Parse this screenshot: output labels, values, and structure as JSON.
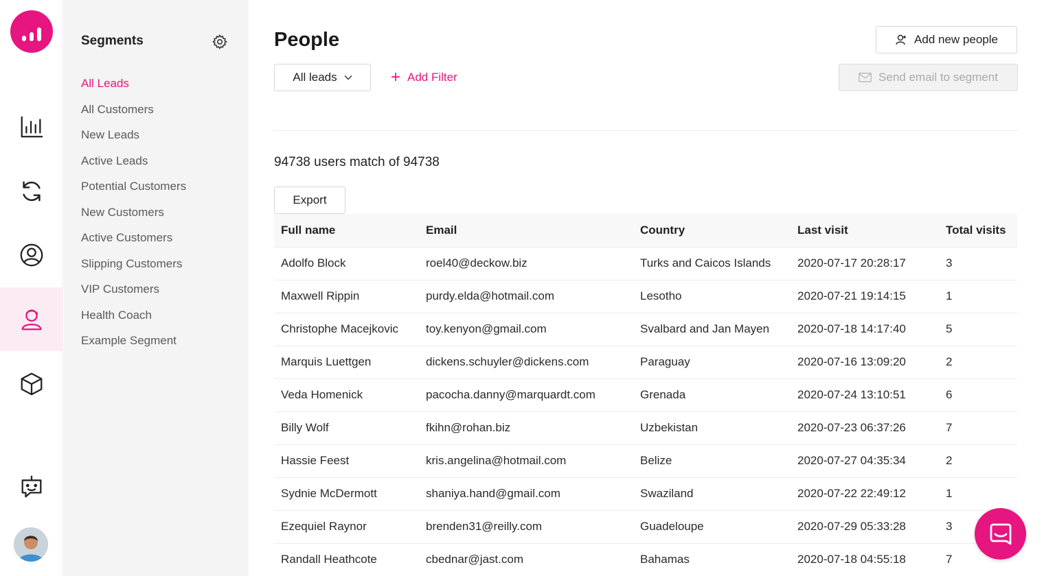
{
  "colors": {
    "accent": "#e6157f",
    "active_bg": "#fcebf3",
    "panel_bg": "#f4f4f4"
  },
  "rail": {
    "items": [
      {
        "name": "analytics-icon"
      },
      {
        "name": "sync-icon"
      },
      {
        "name": "user-circle-icon"
      },
      {
        "name": "people-icon",
        "active": true
      },
      {
        "name": "box-icon"
      },
      {
        "name": "bot-icon"
      }
    ]
  },
  "segments": {
    "title": "Segments",
    "items": [
      {
        "label": "All Leads",
        "active": true
      },
      {
        "label": "All Customers"
      },
      {
        "label": "New Leads"
      },
      {
        "label": "Active Leads"
      },
      {
        "label": "Potential Customers"
      },
      {
        "label": "New Customers"
      },
      {
        "label": "Active Customers"
      },
      {
        "label": "Slipping Customers"
      },
      {
        "label": "VIP Customers"
      },
      {
        "label": "Health Coach"
      },
      {
        "label": "Example Segment"
      }
    ]
  },
  "main": {
    "title": "People",
    "add_people_label": "Add new people",
    "filter_select_value": "All leads",
    "add_filter_label": "Add Filter",
    "send_email_label": "Send email to segment",
    "match_text": "94738 users match of 94738",
    "export_label": "Export"
  },
  "table": {
    "headers": [
      "Full name",
      "Email",
      "Country",
      "Last visit",
      "Total visits"
    ],
    "rows": [
      [
        "Adolfo Block",
        "roel40@deckow.biz",
        "Turks and Caicos Islands",
        "2020-07-17 20:28:17",
        "3"
      ],
      [
        "Maxwell Rippin",
        "purdy.elda@hotmail.com",
        "Lesotho",
        "2020-07-21 19:14:15",
        "1"
      ],
      [
        "Christophe Macejkovic",
        "toy.kenyon@gmail.com",
        "Svalbard and Jan Mayen",
        "2020-07-18 14:17:40",
        "5"
      ],
      [
        "Marquis Luettgen",
        "dickens.schuyler@dickens.com",
        "Paraguay",
        "2020-07-16 13:09:20",
        "2"
      ],
      [
        "Veda Homenick",
        "pacocha.danny@marquardt.com",
        "Grenada",
        "2020-07-24 13:10:51",
        "6"
      ],
      [
        "Billy Wolf",
        "fkihn@rohan.biz",
        "Uzbekistan",
        "2020-07-23 06:37:26",
        "7"
      ],
      [
        "Hassie Feest",
        "kris.angelina@hotmail.com",
        "Belize",
        "2020-07-27 04:35:34",
        "2"
      ],
      [
        "Sydnie McDermott",
        "shaniya.hand@gmail.com",
        "Swaziland",
        "2020-07-22 22:49:12",
        "1"
      ],
      [
        "Ezequiel Raynor",
        "brenden31@reilly.com",
        "Guadeloupe",
        "2020-07-29 05:33:28",
        "3"
      ],
      [
        "Randall Heathcote",
        "cbednar@jast.com",
        "Bahamas",
        "2020-07-18 04:55:18",
        "7"
      ]
    ]
  }
}
